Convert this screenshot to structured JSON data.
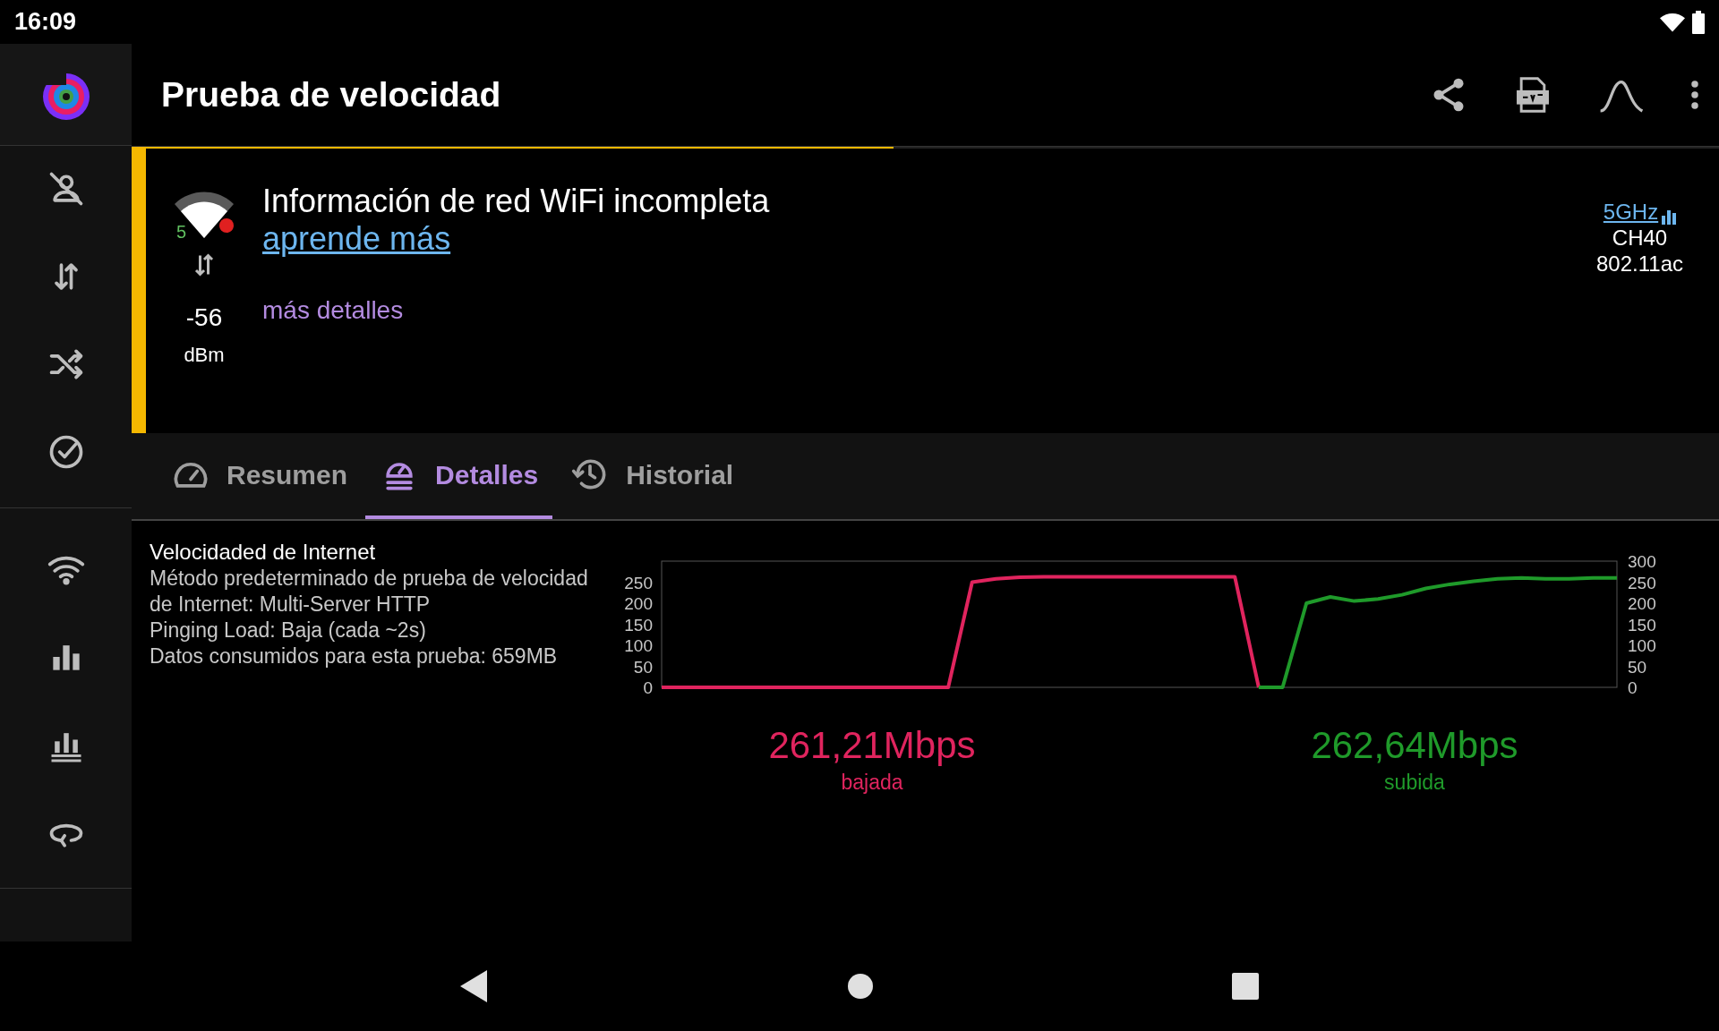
{
  "status_bar": {
    "time": "16:09"
  },
  "app_bar": {
    "title": "Prueba de velocidad",
    "progress": {
      "level": 0.48
    }
  },
  "wifi_card": {
    "band_digit": "5",
    "signal": "-56",
    "signal_unit": "dBm",
    "heading": "Información de red WiFi incompleta",
    "learn_link": "aprende más",
    "details_link": "más detalles",
    "band": "5GHz",
    "channel": "CH40",
    "standard": "802.11ac"
  },
  "tabs": [
    {
      "label": "Resumen",
      "selected": false
    },
    {
      "label": "Detalles",
      "selected": true
    },
    {
      "label": "Historial",
      "selected": false
    }
  ],
  "details": {
    "title": "Velocidaded de Internet",
    "lines": [
      "Método predeterminado de prueba de velocidad de Internet: Multi-Server HTTP",
      "Pinging Load: Baja (cada ~2s)",
      "Datos consumidos para esta prueba: 659MB"
    ],
    "chart_data": {
      "type": "line",
      "categories": [
        null,
        null,
        null,
        null,
        null,
        null,
        null,
        null,
        null,
        null,
        null,
        null,
        null,
        null,
        null,
        null,
        null,
        null,
        null,
        null,
        null,
        null,
        null,
        null,
        null,
        null,
        null,
        null,
        null,
        null,
        null,
        null,
        null,
        null,
        null,
        null,
        null,
        null,
        null,
        null,
        null
      ],
      "ylim": [
        0,
        300
      ],
      "y2lim": [
        0,
        300
      ],
      "yticks": [
        0,
        50,
        100,
        150,
        200,
        250
      ],
      "y2ticks": [
        0,
        50,
        100,
        150,
        200,
        250,
        300
      ],
      "series": [
        {
          "name": "bajada",
          "color": "#e0245e",
          "values": [
            0,
            0,
            0,
            0,
            0,
            0,
            0,
            0,
            0,
            0,
            0,
            0,
            0,
            250,
            258,
            262,
            263,
            263,
            263,
            263,
            263,
            263,
            263,
            263,
            263,
            0,
            null,
            null,
            null,
            null,
            null,
            null,
            null,
            null,
            null,
            null,
            null,
            null,
            null,
            null,
            null
          ]
        },
        {
          "name": "subida",
          "color": "#1f9a2a",
          "values": [
            null,
            null,
            null,
            null,
            null,
            null,
            null,
            null,
            null,
            null,
            null,
            null,
            null,
            null,
            null,
            null,
            null,
            null,
            null,
            null,
            null,
            null,
            null,
            null,
            null,
            0,
            0,
            200,
            215,
            205,
            210,
            220,
            235,
            245,
            252,
            258,
            260,
            258,
            258,
            260,
            260
          ]
        }
      ]
    },
    "results": [
      {
        "value": "261,21Mbps"
      },
      {
        "value": "262,64Mbps"
      }
    ]
  }
}
